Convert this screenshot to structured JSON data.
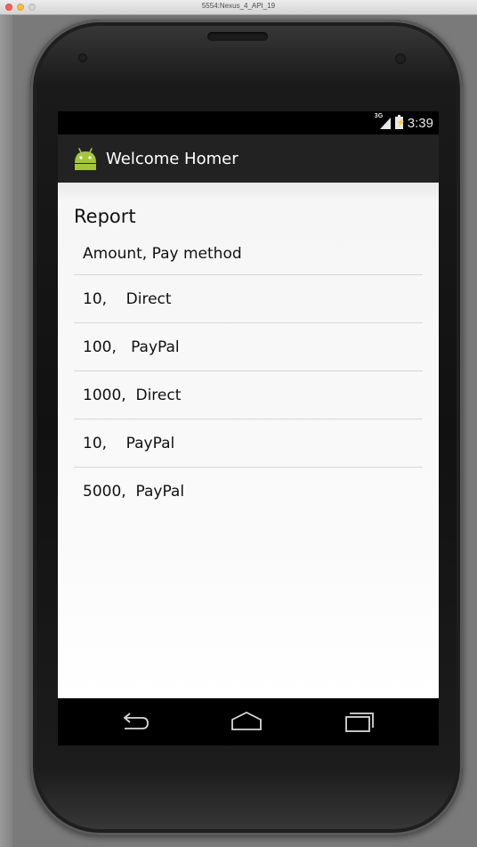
{
  "window": {
    "title": "5554:Nexus_4_API_19"
  },
  "statusbar": {
    "network": "3G",
    "time": "3:39"
  },
  "actionbar": {
    "title": "Welcome Homer",
    "logo_icon": "android-robot-icon"
  },
  "report": {
    "heading": "Report",
    "rows": [
      "Amount, Pay method",
      "10,    Direct",
      "100,   PayPal",
      "1000,  Direct",
      "10,    PayPal",
      "5000,  PayPal"
    ]
  },
  "navbar": {
    "back_icon": "back-icon",
    "home_icon": "home-icon",
    "recents_icon": "recent-apps-icon"
  },
  "colors": {
    "actionbar_bg": "#222222",
    "content_bg": "#f7f7f7",
    "android_green": "#a4c639"
  }
}
